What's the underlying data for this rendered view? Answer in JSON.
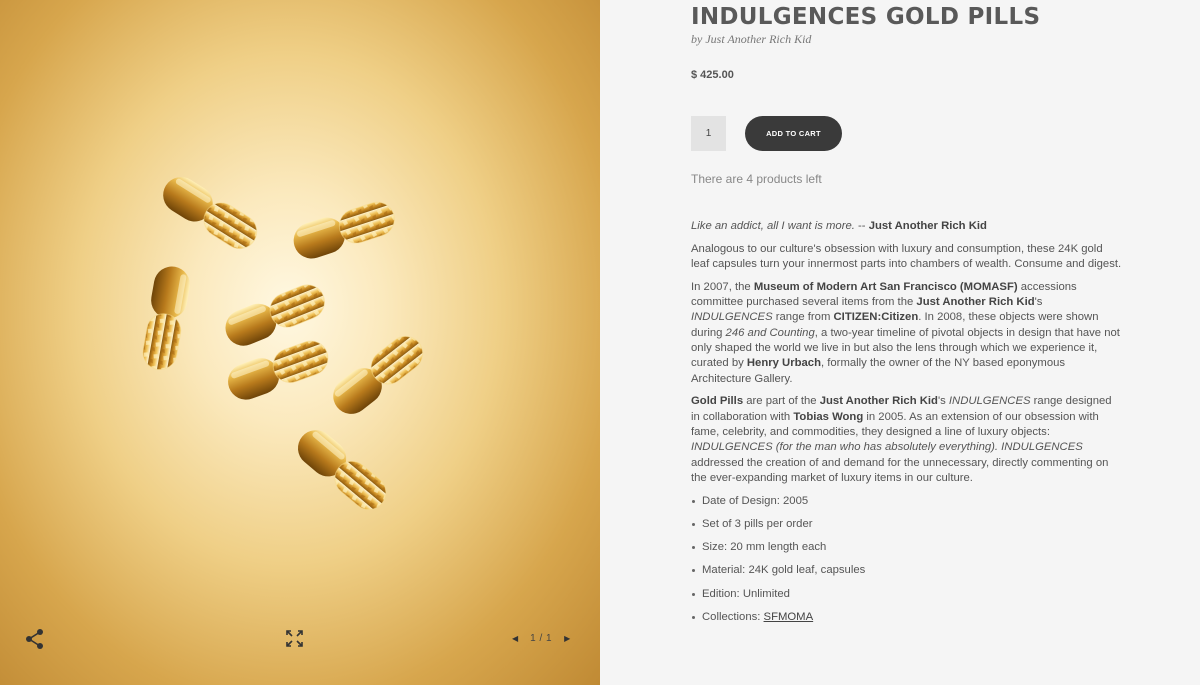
{
  "gallery": {
    "image_alt": "Gold pills capsules on gold background",
    "pager": "1 / 1",
    "icons": {
      "share": "share-icon",
      "expand": "expand-icon",
      "prev": "chevron-left-icon",
      "next": "chevron-right-icon"
    }
  },
  "product": {
    "title": "INDULGENCES GOLD PILLS",
    "byline": "by Just Another Rich Kid",
    "price": "$ 425.00",
    "quantity": "1",
    "add_to_cart": "ADD TO CART",
    "stock": "There are 4 products left"
  },
  "description": {
    "quote": "Like an addict, all I want is more.",
    "quote_sep": " -- ",
    "quote_author": "Just Another Rich Kid",
    "p1": "Analogous to our culture's obsession with luxury and consumption, these 24K gold leaf capsules turn your innermost parts into chambers of wealth. Consume and digest.",
    "p2": {
      "a": "In 2007, the ",
      "b": "Museum of Modern Art San Francisco (MOMASF)",
      "c": " accessions committee purchased several items from the ",
      "d": "Just Another Rich Kid",
      "e": "'s ",
      "f": "INDULGENCES",
      "g": " range from ",
      "h": "CITIZEN:Citizen",
      "i": ". In 2008, these objects were shown during ",
      "j": "246 and Counting",
      "k": ", a two-year timeline of pivotal objects in design that have not only shaped the world we live in but also the lens through which we experience it, curated by ",
      "l": "Henry Urbach",
      "m": ", formally the owner of the NY based eponymous Architecture Gallery."
    },
    "p3": {
      "a": "Gold Pills",
      "b": " are part of the ",
      "c": "Just Another Rich Kid",
      "d": "'s ",
      "e": "INDULGENCES",
      "f": " range designed in collaboration with ",
      "g": "Tobias Wong",
      "h": " in 2005. As an extension of our obsession with fame, celebrity, and commodities, they designed a line of luxury objects: ",
      "i": "INDULGENCES (for the man who has absolutely everything). INDULGENCES",
      "j": " addressed the creation of and demand for the unnecessary, directly commenting on the ever-expanding market of luxury items in our culture."
    },
    "specs": [
      "Date of Design: 2005",
      "Set of 3 pills per order",
      "Size: 20 mm length each",
      "Material: 24K gold leaf, capsules",
      "Edition: Unlimited"
    ],
    "collections_label": "Collections: ",
    "collections_link": "SFMOMA"
  },
  "colors": {
    "background": "#f5f5f5",
    "button": "#3a3a3a",
    "title": "#595959",
    "gold": "#d4a23c"
  }
}
